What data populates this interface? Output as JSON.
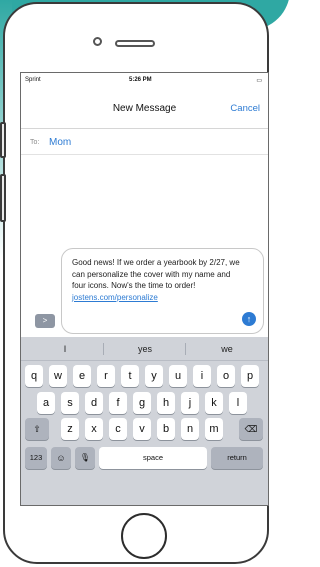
{
  "status_bar": {
    "carrier": "Sprint",
    "time": "5:26 PM",
    "battery": "•"
  },
  "header": {
    "title": "New Message",
    "cancel": "Cancel"
  },
  "recipient": {
    "label": "To:",
    "name": "Mom"
  },
  "message": {
    "text": "Good news! If we order a yearbook by 2/27, we can personalize the cover with my name and four icons. Now's the time to order!",
    "link": "jostens.com/personalize"
  },
  "suggestions": [
    "I",
    "yes",
    "we"
  ],
  "keyboard": {
    "row1": [
      "q",
      "w",
      "e",
      "r",
      "t",
      "y",
      "u",
      "i",
      "o",
      "p"
    ],
    "row2": [
      "a",
      "s",
      "d",
      "f",
      "g",
      "h",
      "j",
      "k",
      "l"
    ],
    "row3": [
      "z",
      "x",
      "c",
      "v",
      "b",
      "n",
      "m"
    ],
    "shift": "⇧",
    "delete": "⌫",
    "numbers": "123",
    "emoji": "☺",
    "mic": "🎙",
    "space": "space",
    "return": "return"
  },
  "icons": {
    "send": "arrow-up-icon",
    "apps": "apps-chevron-icon"
  },
  "colors": {
    "accent": "#2d7bd3",
    "keyboard_bg": "#d0d3d9",
    "brand_bg": "#2fa8a3"
  }
}
